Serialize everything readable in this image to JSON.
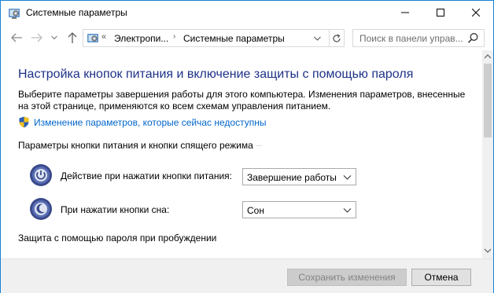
{
  "window": {
    "title": "Системные параметры"
  },
  "nav": {
    "breadcrumb": [
      "«",
      "Электропи...",
      "›",
      "Системные параметры"
    ],
    "search_placeholder": "Поиск в панели управ..."
  },
  "main": {
    "title": "Настройка кнопок питания и включение защиты с помощью пароля",
    "description": "Выберите параметры завершения работы для этого компьютера. Изменения параметров, внесенные на этой странице, применяются ко всем схемам управления питанием.",
    "admin_link": "Изменение параметров, которые сейчас недоступны",
    "buttons_group": {
      "heading": "Параметры кнопки питания и кнопки спящего режима",
      "rows": [
        {
          "label": "Действие при нажатии кнопки питания:",
          "value": "Завершение работы"
        },
        {
          "label": "При нажатии кнопки сна:",
          "value": "Сон"
        }
      ]
    },
    "password_group": {
      "heading": "Защита с помощью пароля при пробуждении"
    }
  },
  "footer": {
    "save_label": "Сохранить изменения",
    "cancel_label": "Отмена"
  },
  "colors": {
    "title_blue": "#1e3287",
    "link_blue": "#0066cc",
    "window_border": "#1883d7"
  },
  "icons": {
    "title": "control-panel-icon",
    "shield": "uac-shield-icon",
    "power": "power-button-icon",
    "sleep": "sleep-button-icon"
  }
}
